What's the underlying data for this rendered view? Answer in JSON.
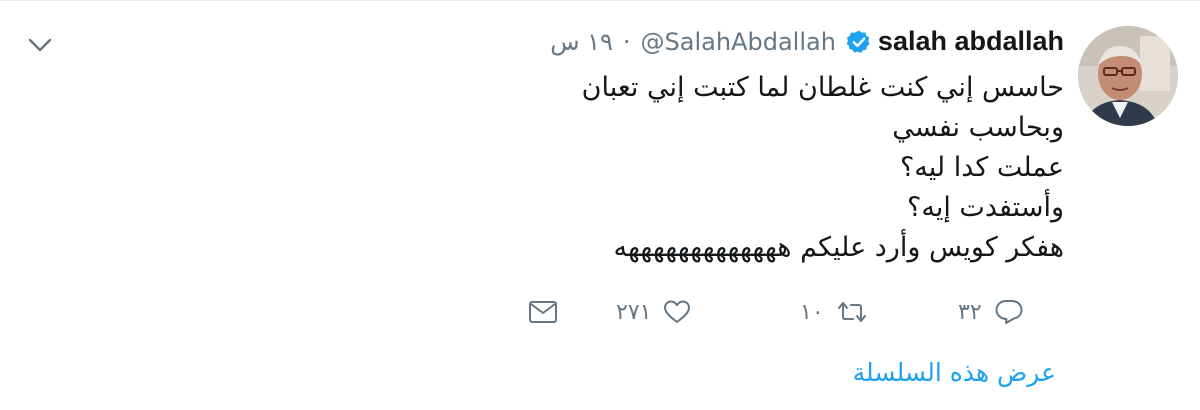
{
  "tweet": {
    "author": {
      "display_name": "salah abdallah",
      "handle": "@SalahAbdallah",
      "verified": true,
      "avatar_icon": "profile-photo"
    },
    "time": "١٩ س",
    "separator": "·",
    "body_lines": [
      "حاسس إني كنت غلطان لما كتبت إني تعبان",
      "وبحاسب نفسي",
      "عملت كدا ليه؟",
      "وأستفدت إيه؟",
      "هفكر كويس وأرد عليكم هههههههههههههه"
    ],
    "actions": {
      "reply": {
        "icon": "reply-icon",
        "count": "٣٢"
      },
      "retweet": {
        "icon": "retweet-icon",
        "count": "١٠"
      },
      "like": {
        "icon": "heart-icon",
        "count": "٢٧١"
      },
      "message": {
        "icon": "envelope-icon",
        "count": ""
      }
    },
    "show_thread": "عرض هذه السلسلة",
    "menu_icon": "chevron-down-icon"
  },
  "colors": {
    "text": "#14171a",
    "muted": "#657786",
    "link": "#1da1f2",
    "verified": "#1da1f2",
    "divider": "#e6ecf0"
  }
}
